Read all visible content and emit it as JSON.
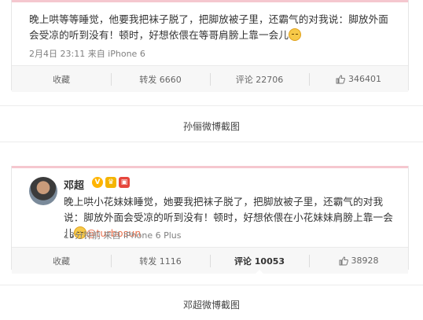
{
  "post1": {
    "text": "晚上哄等等睡觉，他要我把袜子脱了，把脚放被子里，还霸气的对我说：脚放外面会受凉的听到没有！顿时，好想依偎在等哥肩膀上靠一会儿",
    "meta": "2月4日 23:11 来自 iPhone 6",
    "actions": {
      "favorite": "收藏",
      "repost": "转发 6660",
      "comment": "评论 22706",
      "like": "346401"
    },
    "caption": "孙俪微博截图"
  },
  "post2": {
    "username": "邓超",
    "text": "晚上哄小花妹妹睡觉，她要我把袜子脱了，把脚放被子里，还霸气的对我说：脚放外面会受凉的听到没有！顿时，好想依偎在小花妹妹肩膀上靠一会儿",
    "mention": "@turbosun",
    "meta": "13分钟前 来自 iPhone 6 Plus",
    "actions": {
      "favorite": "收藏",
      "repost": "转发 1116",
      "comment": "评论 10053",
      "like": "38928"
    },
    "caption": "邓超微博截图"
  },
  "icons": {
    "emoji": "blush-emoji-icon",
    "like": "thumbs-up-icon",
    "verified": "verified-v-icon",
    "crown": "vip-crown-icon",
    "level": "level-badge-icon"
  },
  "colors": {
    "pink_bar": "#f5c7cf",
    "mention": "#eb7350",
    "meta": "#808080"
  }
}
